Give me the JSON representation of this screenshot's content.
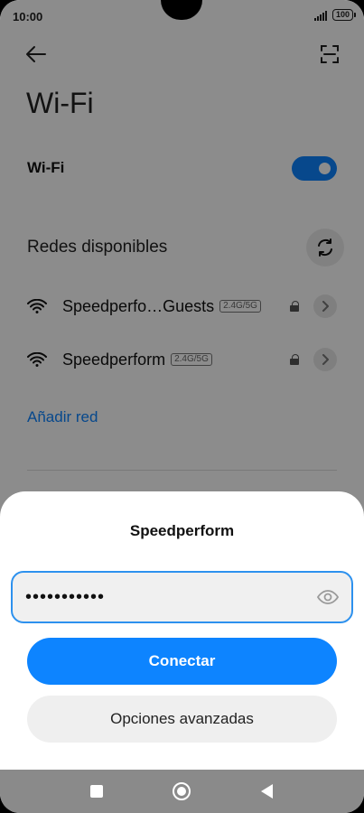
{
  "status_bar": {
    "time": "10:00",
    "battery": "100"
  },
  "page": {
    "title": "Wi-Fi"
  },
  "wifi_toggle": {
    "label": "Wi-Fi",
    "state": "on"
  },
  "networks_section": {
    "title": "Redes disponibles"
  },
  "networks": [
    {
      "name": "Speedperfo…Guests",
      "band": "2.4G/5G",
      "secured": true
    },
    {
      "name": "Speedperform",
      "band": "2.4G/5G",
      "secured": true
    }
  ],
  "add_network": {
    "label": "Añadir red"
  },
  "dialog": {
    "title": "Speedperform",
    "password_value": "•••••••••••",
    "connect_label": "Conectar",
    "advanced_label": "Opciones avanzadas"
  },
  "colors": {
    "accent": "#0d84ff",
    "field_border": "#2d91ee"
  },
  "icons": {
    "back": "arrow-left-icon",
    "scan": "qr-scan-icon",
    "refresh": "refresh-icon",
    "wifi": "wifi-signal-icon",
    "lock": "lock-icon",
    "chevron": "chevron-right-icon",
    "eye": "eye-icon"
  }
}
